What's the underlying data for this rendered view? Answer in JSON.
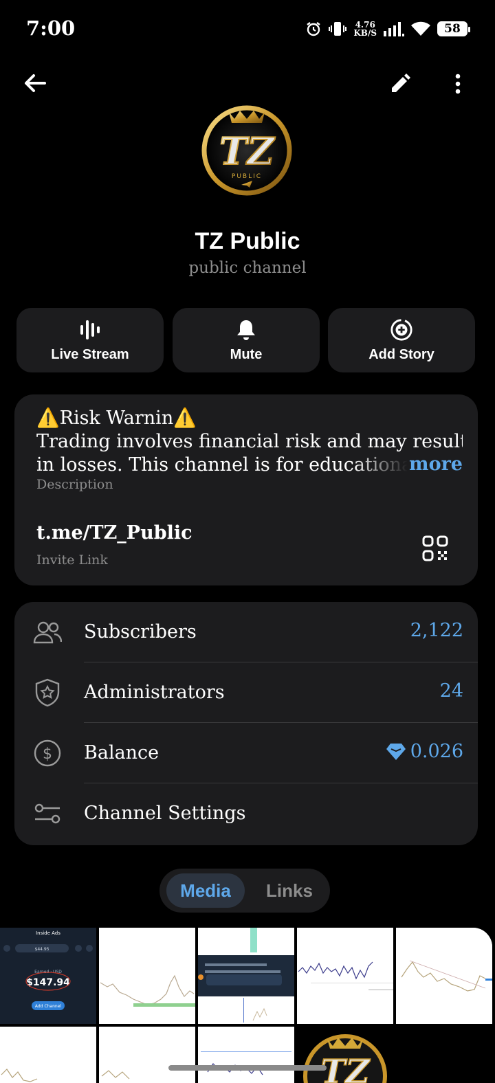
{
  "status_bar": {
    "time": "7:00",
    "net_speed_value": "4.76",
    "net_speed_unit": "KB/S",
    "battery": "58",
    "icons": [
      "alarm-icon",
      "vibrate-icon",
      "signal-icon",
      "wifi-icon",
      "battery-icon"
    ]
  },
  "header": {
    "back_icon": "arrow-left-icon",
    "edit_icon": "pencil-icon",
    "more_icon": "more-vert-icon"
  },
  "channel": {
    "name": "TZ Public",
    "type": "public channel"
  },
  "actions": [
    {
      "label": "Live Stream",
      "icon": "live-stream-icon"
    },
    {
      "label": "Mute",
      "icon": "bell-icon"
    },
    {
      "label": "Add Story",
      "icon": "add-story-icon"
    }
  ],
  "info": {
    "description_line1": "⚠️Risk Warnin⚠️",
    "description_line2": "Trading involves financial risk and may result",
    "description_line3": "in losses. This channel is for educational",
    "more_label": "more",
    "description_caption": "Description",
    "invite_link": "t.me/TZ_Public",
    "invite_caption": "Invite Link"
  },
  "stats": [
    {
      "label": "Subscribers",
      "value": "2,122",
      "icon": "users-icon"
    },
    {
      "label": "Administrators",
      "value": "24",
      "icon": "shield-star-icon"
    },
    {
      "label": "Balance",
      "value": "0.026",
      "icon": "dollar-circle-icon",
      "value_icon": "diamond-icon"
    },
    {
      "label": "Channel Settings",
      "value": "",
      "icon": "settings-sliders-icon"
    }
  ],
  "tabs": [
    {
      "label": "Media",
      "active": true
    },
    {
      "label": "Links",
      "active": false
    }
  ],
  "media": {
    "ad_card_title": "Inside Ads",
    "ad_card_balance": "$44.95",
    "ad_card_earned_label": "Earned · USD",
    "ad_card_earned": "$147.94",
    "ad_card_button": "Add Channel"
  },
  "colors": {
    "background": "#000000",
    "card": "#1c1c1e",
    "accent": "#5ea8ea",
    "secondary_text": "#8d8d8d"
  }
}
